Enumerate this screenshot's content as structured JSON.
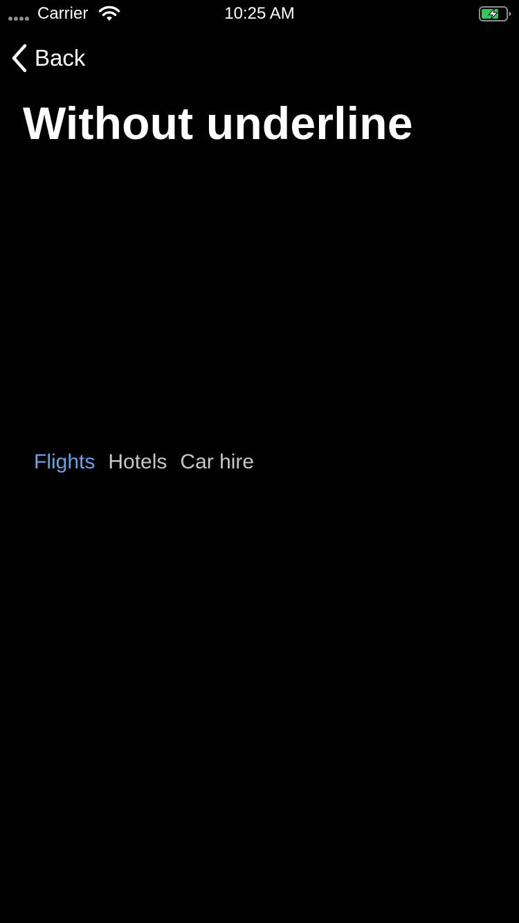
{
  "status_bar": {
    "carrier": "Carrier",
    "time": "10:25 AM",
    "signal_icon": "signal-dots-icon",
    "wifi_icon": "wifi-icon",
    "battery_icon": "battery-charging-icon",
    "battery_color": "#34c759"
  },
  "nav": {
    "back_label": "Back",
    "back_icon": "chevron-left-icon"
  },
  "page": {
    "title": "Without underline"
  },
  "tabs": {
    "active_color": "#6da1e6",
    "inactive_color": "#c7c7cc",
    "items": [
      {
        "label": "Flights",
        "active": true
      },
      {
        "label": "Hotels",
        "active": false
      },
      {
        "label": "Car hire",
        "active": false
      }
    ]
  }
}
